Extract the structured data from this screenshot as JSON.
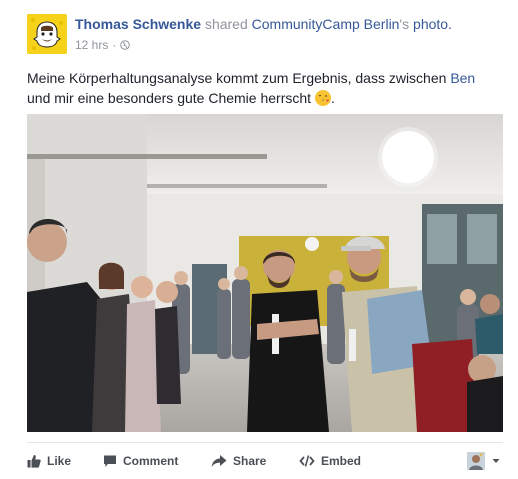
{
  "post": {
    "author": "Thomas Schwenke",
    "verb_shared": "shared",
    "page_name": "CommunityCamp Berlin",
    "possessive": "'s",
    "object": "photo.",
    "timestamp": "12 hrs",
    "dot": "·",
    "caption_part1": "Meine Körperhaltungsanalyse kommt zum Ergebnis, dass zwischen",
    "mention": "Ben",
    "caption_part2": "und mir eine besonders gute Chemie herrscht",
    "caption_end": "."
  },
  "actions": {
    "like": "Like",
    "comment": "Comment",
    "share": "Share",
    "embed": "Embed"
  },
  "colors": {
    "link": "#365899",
    "muted": "#90949c",
    "text": "#1d2129",
    "action": "#4b4f56"
  },
  "icons": {
    "avatar": "snapchat-ghost-avatar",
    "privacy": "globe-icon",
    "emoji": "kissing-face-emoji",
    "like": "thumbs-up-icon",
    "comment": "comment-bubble-icon",
    "share": "share-arrow-icon",
    "embed": "code-brackets-icon",
    "reactions": "profile-reactions-icon"
  }
}
